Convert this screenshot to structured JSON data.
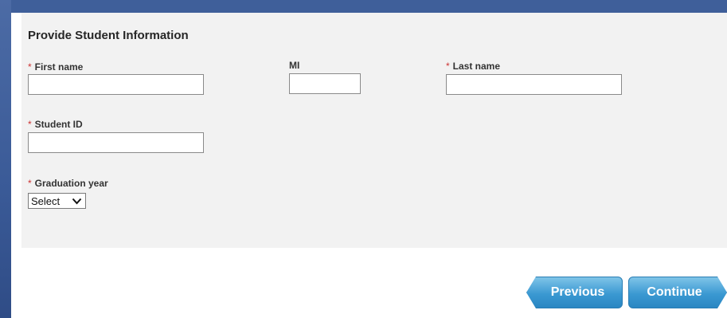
{
  "form": {
    "heading": "Provide Student Information",
    "required_marker": "*",
    "fields": {
      "first_name": {
        "label": "First name",
        "value": "",
        "required": true
      },
      "mi": {
        "label": "MI",
        "value": "",
        "required": false
      },
      "last_name": {
        "label": "Last name",
        "value": "",
        "required": true
      },
      "student_id": {
        "label": "Student ID",
        "value": "",
        "required": true
      },
      "graduation_year": {
        "label": "Graduation year",
        "selected": "Select",
        "required": true
      }
    }
  },
  "nav": {
    "previous_label": "Previous",
    "continue_label": "Continue"
  },
  "colors": {
    "frame_blue": "#3f5f9a",
    "panel_bg": "#f2f2f2",
    "required_red": "#cc3333",
    "button_blue": "#3b99d2"
  }
}
